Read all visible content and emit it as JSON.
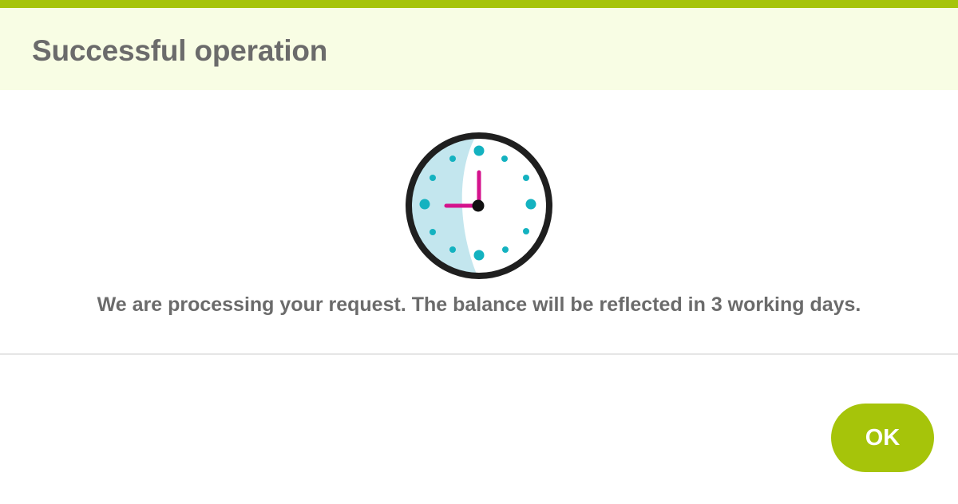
{
  "dialog": {
    "title": "Successful operation",
    "message": "We are processing your request. The balance will be reflected in 3 working days.",
    "ok_label": "OK"
  },
  "colors": {
    "accent": "#a6c40a",
    "header_background": "#f8fde4",
    "text": "#6b6b6b",
    "clock_hands": "#d4138c",
    "clock_dots": "#14b2c0",
    "clock_shade": "#c3e6ee"
  },
  "icons": {
    "status_icon": "clock-icon"
  }
}
